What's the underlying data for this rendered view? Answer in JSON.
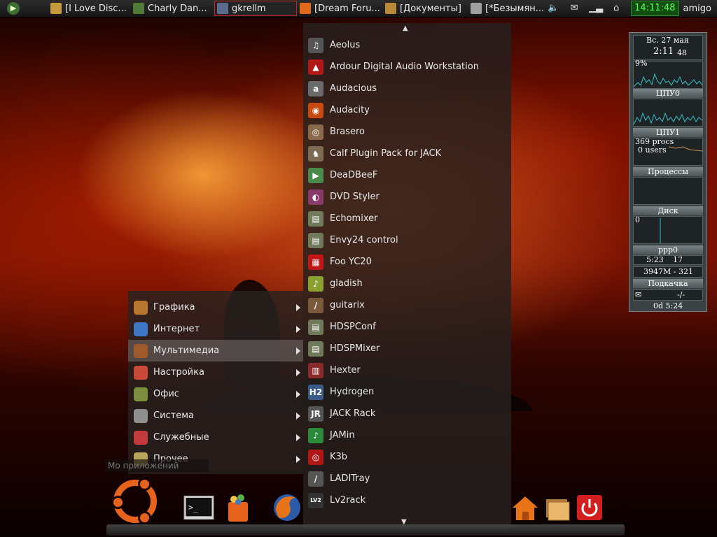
{
  "taskbar": {
    "tasks": [
      {
        "label": "[I Love Disc...",
        "color": "#c79a3c"
      },
      {
        "label": "Charly Dan...",
        "color": "#4f7a3a"
      },
      {
        "label": "gkrellm",
        "color": "#5a6b8c"
      },
      {
        "label": "[Dream Foru...",
        "color": "#e06a1b"
      },
      {
        "label": "[Документы]",
        "color": "#b88a3a"
      },
      {
        "label": "[*Безымян...",
        "color": "#a0a0a0"
      }
    ],
    "clock": "14:11:48",
    "user": "amigo"
  },
  "menu": {
    "categories": [
      {
        "label": "Графика",
        "color": "#b7772f"
      },
      {
        "label": "Интернет",
        "color": "#3f79c6"
      },
      {
        "label": "Мультимедиа",
        "color": "#a05a2a"
      },
      {
        "label": "Настройка",
        "color": "#c94a38"
      },
      {
        "label": "Офис",
        "color": "#7b8f3e"
      },
      {
        "label": "Система",
        "color": "#8f8f8f"
      },
      {
        "label": "Служебные",
        "color": "#c23a3a"
      },
      {
        "label": "Прочее",
        "color": "#b8a35a"
      }
    ],
    "active_category": "Мультимедиа",
    "search_placeholder": "Мо приложений",
    "apps": [
      {
        "label": "Aeolus",
        "glyph": "♫",
        "color": "#555555"
      },
      {
        "label": "Ardour Digital Audio Workstation",
        "glyph": "▲",
        "color": "#b01818"
      },
      {
        "label": "Audacious",
        "glyph": "a",
        "color": "#6a6a6a"
      },
      {
        "label": "Audacity",
        "glyph": "◉",
        "color": "#c84a12"
      },
      {
        "label": "Brasero",
        "glyph": "◎",
        "color": "#8a6a4a"
      },
      {
        "label": "Calf Plugin Pack for JACK",
        "glyph": "♞",
        "color": "#7c6a52"
      },
      {
        "label": "DeaDBeeF",
        "glyph": "▶",
        "color": "#4a8a4a"
      },
      {
        "label": "DVD Styler",
        "glyph": "◐",
        "color": "#8a3a6a"
      },
      {
        "label": "Echomixer",
        "glyph": "▤",
        "color": "#6f7a5a"
      },
      {
        "label": "Envy24 control",
        "glyph": "▤",
        "color": "#6f7a5a"
      },
      {
        "label": "Foo YC20",
        "glyph": "▦",
        "color": "#c01818"
      },
      {
        "label": "gladish",
        "glyph": "♪",
        "color": "#8aa030"
      },
      {
        "label": "guitarix",
        "glyph": "/",
        "color": "#7a5a3a"
      },
      {
        "label": "HDSPConf",
        "glyph": "▤",
        "color": "#6f7a5a"
      },
      {
        "label": "HDSPMixer",
        "glyph": "▤",
        "color": "#6f7a5a"
      },
      {
        "label": "Hexter",
        "glyph": "▥",
        "color": "#8a2a2a"
      },
      {
        "label": "Hydrogen",
        "glyph": "H2",
        "color": "#3a5a8a"
      },
      {
        "label": "JACK Rack",
        "glyph": "JR",
        "color": "#555555"
      },
      {
        "label": "JAMin",
        "glyph": "♪",
        "color": "#2a8a3a"
      },
      {
        "label": "K3b",
        "glyph": "◎",
        "color": "#b01818"
      },
      {
        "label": "LADITray",
        "glyph": "/",
        "color": "#555555"
      },
      {
        "label": "Lv2rack",
        "glyph": "LV2",
        "color": "#333333"
      }
    ]
  },
  "gkrellm": {
    "date": "Вс. 27 мая",
    "time": "2:11",
    "seconds": "48",
    "cpu_percent": "9%",
    "cpu0_label": "ЦПУ0",
    "cpu1_label": "ЦПУ1",
    "procs": "369 procs",
    "users": "0 users",
    "procs_label": "Процессы",
    "disk_value": "0",
    "disk_label": "Диск",
    "net_label": "ppp0",
    "net_time": "5:23",
    "net_extra": "17",
    "net_total": "3947M - 321",
    "download_label": "Подкачка",
    "mail_label": "-/-",
    "uptime": "0d 5:24"
  },
  "icons": {
    "launcher": "start-arrow-icon",
    "tray": [
      "volume-icon",
      "mail-icon",
      "network-signal-icon",
      "network-monitor-icon"
    ],
    "dock": [
      "ubuntu-icon",
      "terminal-icon",
      "software-center-icon",
      "firefox-icon",
      "home-folder-icon",
      "folders-icon",
      "power-icon"
    ]
  }
}
